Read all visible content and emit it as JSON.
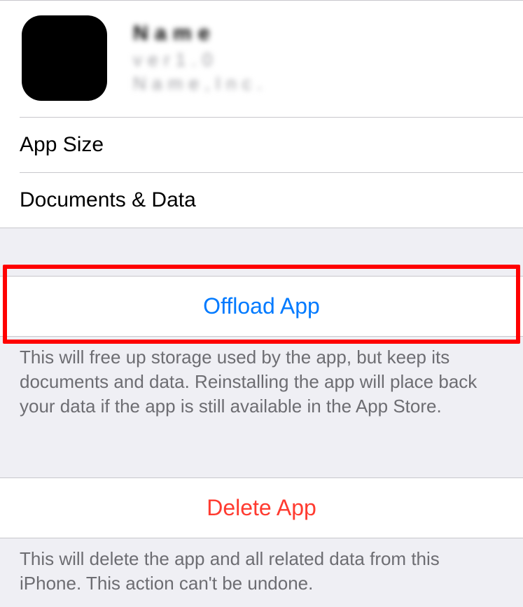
{
  "app": {
    "name_obscured": "N a m e",
    "version_obscured": "v e r  1 . 0",
    "publisher_obscured": "N a m e ,  I n c ."
  },
  "info": {
    "app_size_label": "App Size",
    "app_size_value": "",
    "docs_label": "Documents & Data",
    "docs_value": ""
  },
  "actions": {
    "offload": {
      "label": "Offload App",
      "note": "This will free up storage used by the app, but keep its documents and data. Reinstalling the app will place back your data if the app is still available in the App Store."
    },
    "delete": {
      "label": "Delete App",
      "note": "This will delete the app and all related data from this iPhone. This action can't be undone."
    }
  }
}
